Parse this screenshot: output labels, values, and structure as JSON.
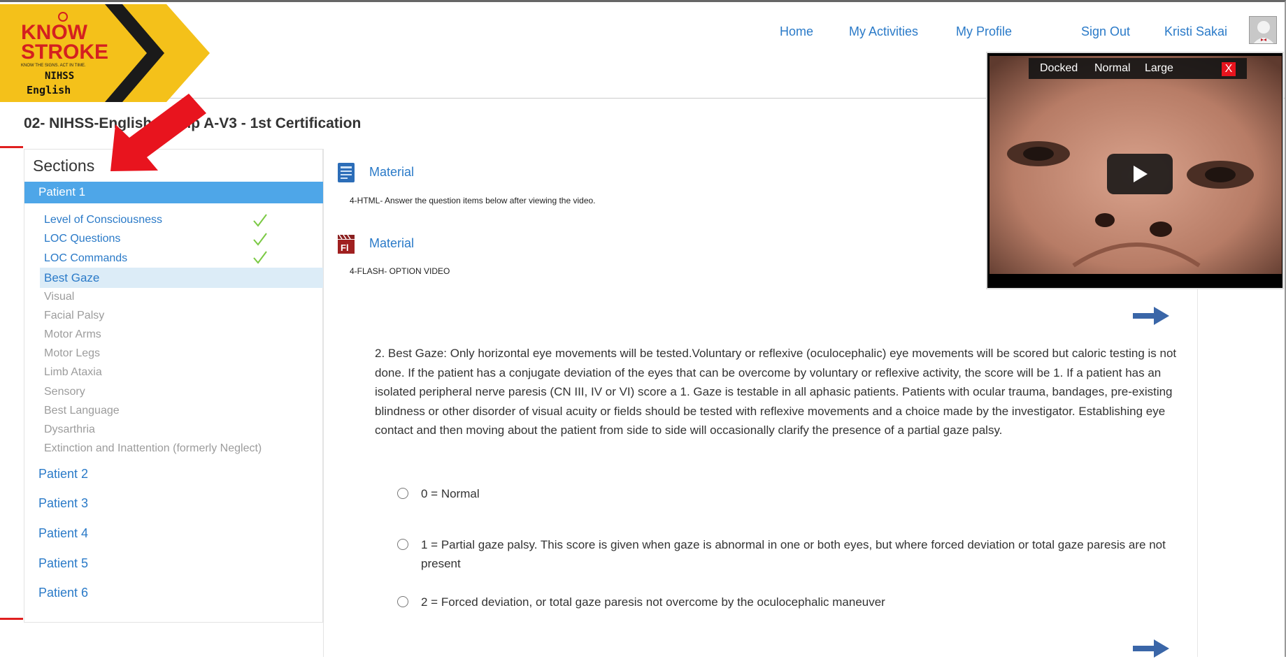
{
  "header": {
    "logo": {
      "line1": "KNOW",
      "line2": "STROKE",
      "tagline": "KNOW THE SIGNS. ACT IN TIME.",
      "line3": "NIHSS",
      "line4": "English"
    },
    "nav": {
      "home": "Home",
      "activities": "My Activities",
      "profile": "My Profile",
      "signout": "Sign Out",
      "user": "Kristi Sakai"
    }
  },
  "video": {
    "docked": "Docked",
    "normal": "Normal",
    "large": "Large",
    "close": "X"
  },
  "page": {
    "title": "02- NIHSS-English Group A-V3 - 1st Certification"
  },
  "sidebar": {
    "title": "Sections",
    "active_patient": "Patient 1",
    "items": [
      {
        "label": "Level of Consciousness",
        "state": "done"
      },
      {
        "label": "LOC Questions",
        "state": "done"
      },
      {
        "label": "LOC Commands",
        "state": "done"
      },
      {
        "label": "Best Gaze",
        "state": "current"
      },
      {
        "label": "Visual",
        "state": "future"
      },
      {
        "label": "Facial Palsy",
        "state": "future"
      },
      {
        "label": "Motor Arms",
        "state": "future"
      },
      {
        "label": "Motor Legs",
        "state": "future"
      },
      {
        "label": "Limb Ataxia",
        "state": "future"
      },
      {
        "label": "Sensory",
        "state": "future"
      },
      {
        "label": "Best Language",
        "state": "future"
      },
      {
        "label": "Dysarthria",
        "state": "future"
      },
      {
        "label": "Extinction and Inattention (formerly Neglect)",
        "state": "future"
      }
    ],
    "patients": [
      "Patient 2",
      "Patient 3",
      "Patient 4",
      "Patient 5",
      "Patient 6"
    ]
  },
  "materials": [
    {
      "label": "Material",
      "description": "4-HTML- Answer the question items below after viewing the video.",
      "icon": "html-document-icon"
    },
    {
      "label": "Material",
      "description": "4-FLASH- OPTION VIDEO",
      "icon": "flash-video-icon"
    }
  ],
  "question": {
    "text": "2. Best Gaze: Only horizontal eye movements will be tested.Voluntary or reflexive (oculocephalic) eye movements will be scored but caloric testing is not done. If the patient has a conjugate deviation of the eyes that can be overcome by voluntary or reflexive activity, the score will be 1. If a patient has an isolated peripheral nerve paresis (CN III, IV or VI) score a 1. Gaze is testable in all aphasic patients. Patients with ocular trauma, bandages, pre-existing blindness or other disorder of visual acuity or fields should be tested with reflexive movements and a choice made by the investigator. Establishing eye contact and then moving about the patient from side to side will occasionally clarify the presence of a partial gaze palsy.",
    "options": [
      "0 = Normal",
      "1 = Partial gaze palsy. This score is given when gaze is abnormal in one or both eyes, but where forced deviation or total gaze paresis are not present",
      "2 = Forced deviation, or total gaze paresis not overcome by the oculocephalic maneuver"
    ]
  },
  "colors": {
    "link": "#2a7ac8",
    "active_bg": "#4ea6e8",
    "current_bg": "#dcecf7",
    "check": "#7ac943",
    "annotation_arrow": "#e8141e",
    "next_arrow": "#3a66a8"
  }
}
